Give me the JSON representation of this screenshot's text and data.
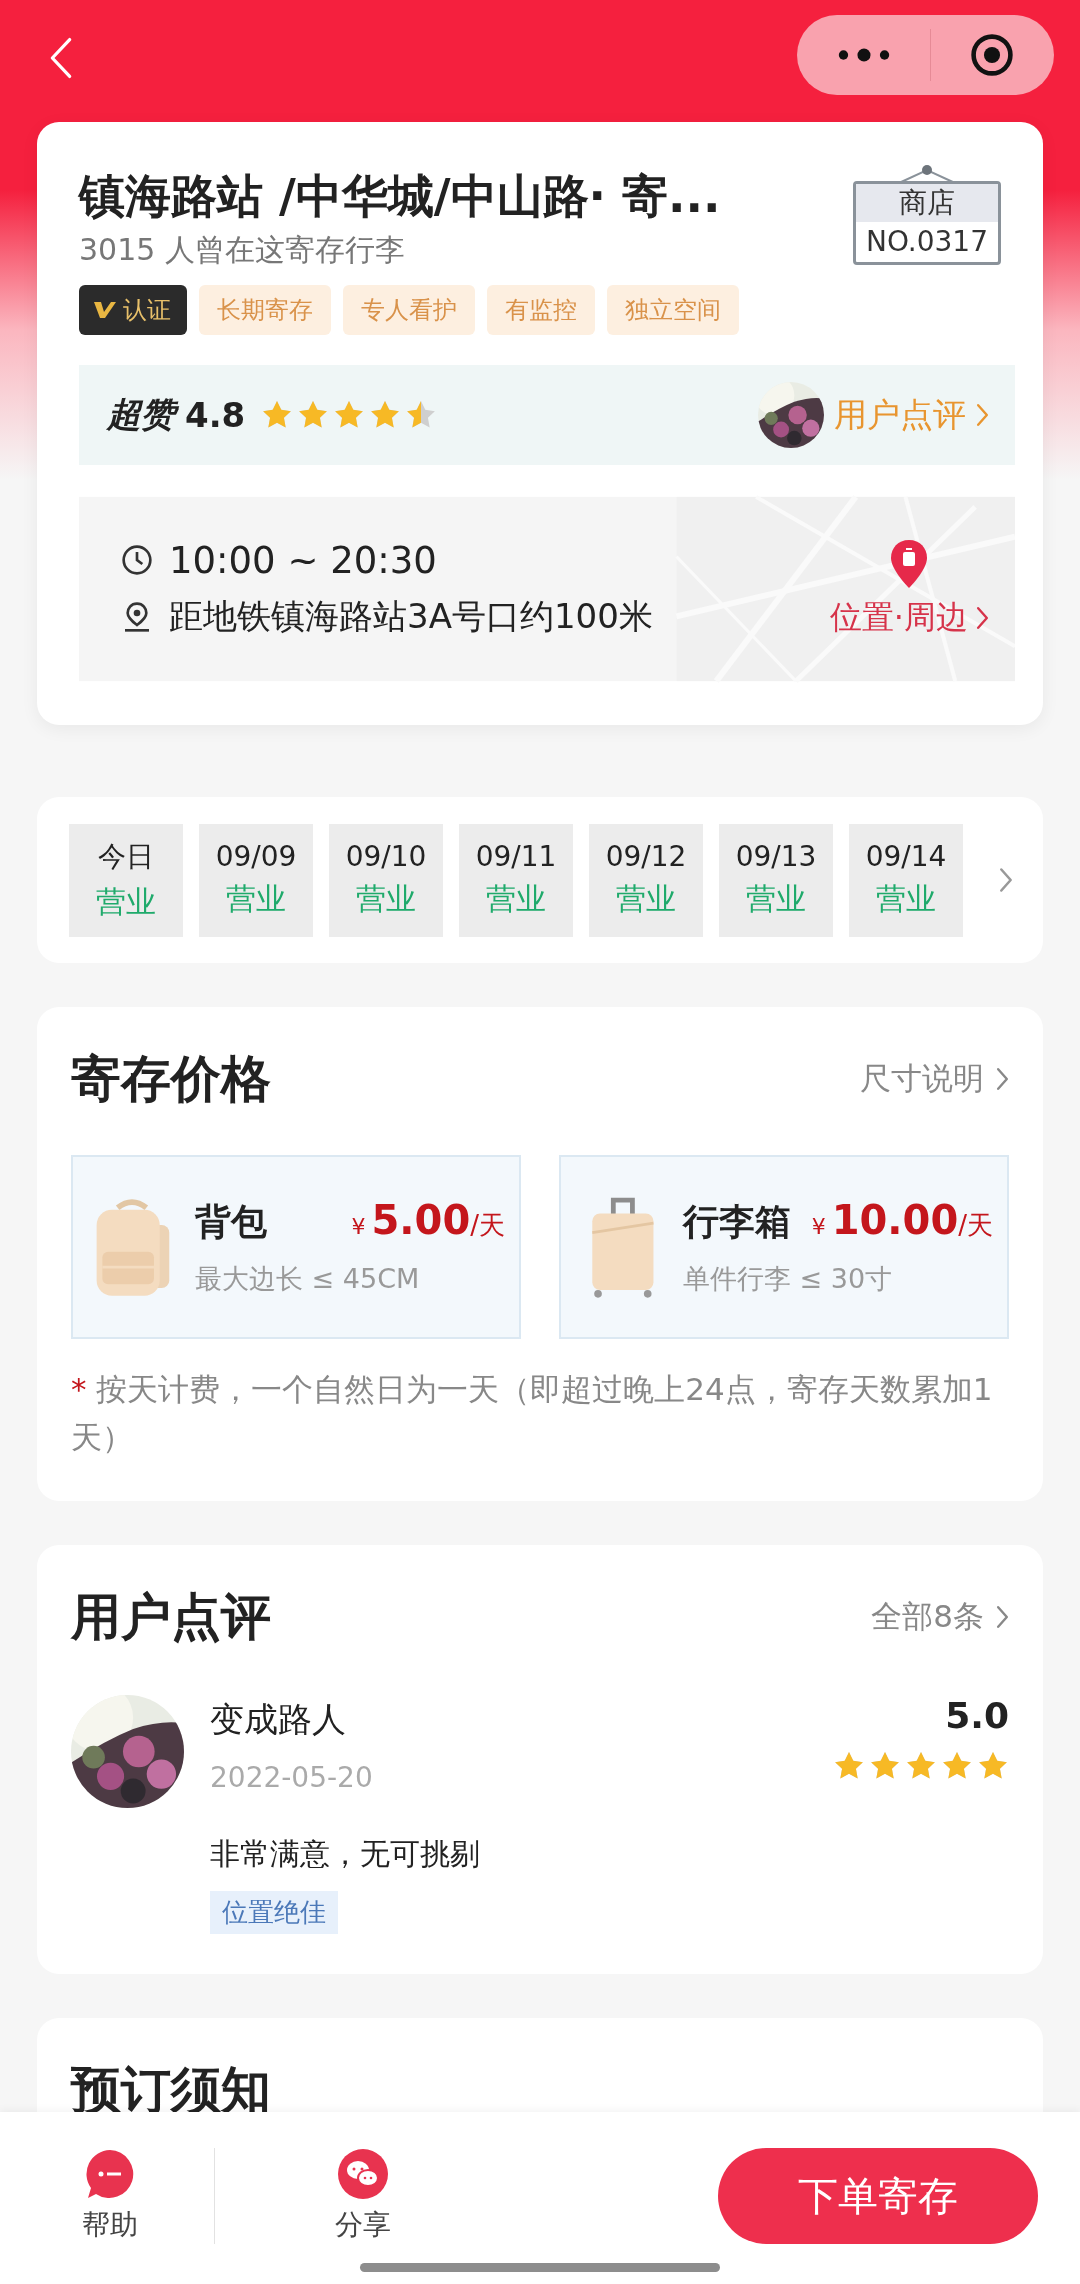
{
  "store": {
    "title": "镇海路站 /中华城/中山路· 寄...",
    "visitors": "3015 人曾在这寄存行李",
    "sign": {
      "label": "商店",
      "number": "NO.0317"
    },
    "tags": [
      {
        "kind": "verified",
        "label": "认证"
      },
      {
        "kind": "feature",
        "label": "长期寄存"
      },
      {
        "kind": "feature",
        "label": "专人看护"
      },
      {
        "kind": "feature",
        "label": "有监控"
      },
      {
        "kind": "feature",
        "label": "独立空间"
      }
    ],
    "rating": {
      "label": "超赞",
      "score": "4.8",
      "stars": 4.5,
      "link": "用户点评"
    },
    "hours": "10:00 ~ 20:30",
    "distance": "距地铁镇海路站3A号口约100米",
    "map_link": "位置·周边"
  },
  "days": [
    {
      "date": "今日",
      "status": "营业"
    },
    {
      "date": "09/09",
      "status": "营业"
    },
    {
      "date": "09/10",
      "status": "营业"
    },
    {
      "date": "09/11",
      "status": "营业"
    },
    {
      "date": "09/12",
      "status": "营业"
    },
    {
      "date": "09/13",
      "status": "营业"
    },
    {
      "date": "09/14",
      "status": "营业"
    }
  ],
  "pricing": {
    "title": "寄存价格",
    "link": "尺寸说明",
    "items": [
      {
        "kind": "backpack",
        "name": "背包",
        "currency": "¥",
        "price": "5.00",
        "unit": "/天",
        "limit": "最大边长 ≤ 45CM"
      },
      {
        "kind": "suitcase",
        "name": "行李箱",
        "currency": "¥",
        "price": "10.00",
        "unit": "/天",
        "limit": "单件行李 ≤ 30寸"
      }
    ],
    "note_mark": "*",
    "note": "按天计费，一个自然日为一天（即超过晚上24点，寄存天数累加1天）"
  },
  "reviews": {
    "title": "用户点评",
    "link": "全部8条",
    "items": [
      {
        "user": "变成路人",
        "date": "2022-05-20",
        "score": "5.0",
        "stars": 5,
        "text": "非常满意，无可挑剔",
        "tags": [
          "位置绝佳"
        ]
      }
    ]
  },
  "notice": {
    "title": "预订须知"
  },
  "bottom_bar": {
    "actions": [
      {
        "kind": "help",
        "label": "帮助"
      },
      {
        "kind": "share",
        "label": "分享"
      }
    ],
    "primary": "下单寄存"
  }
}
